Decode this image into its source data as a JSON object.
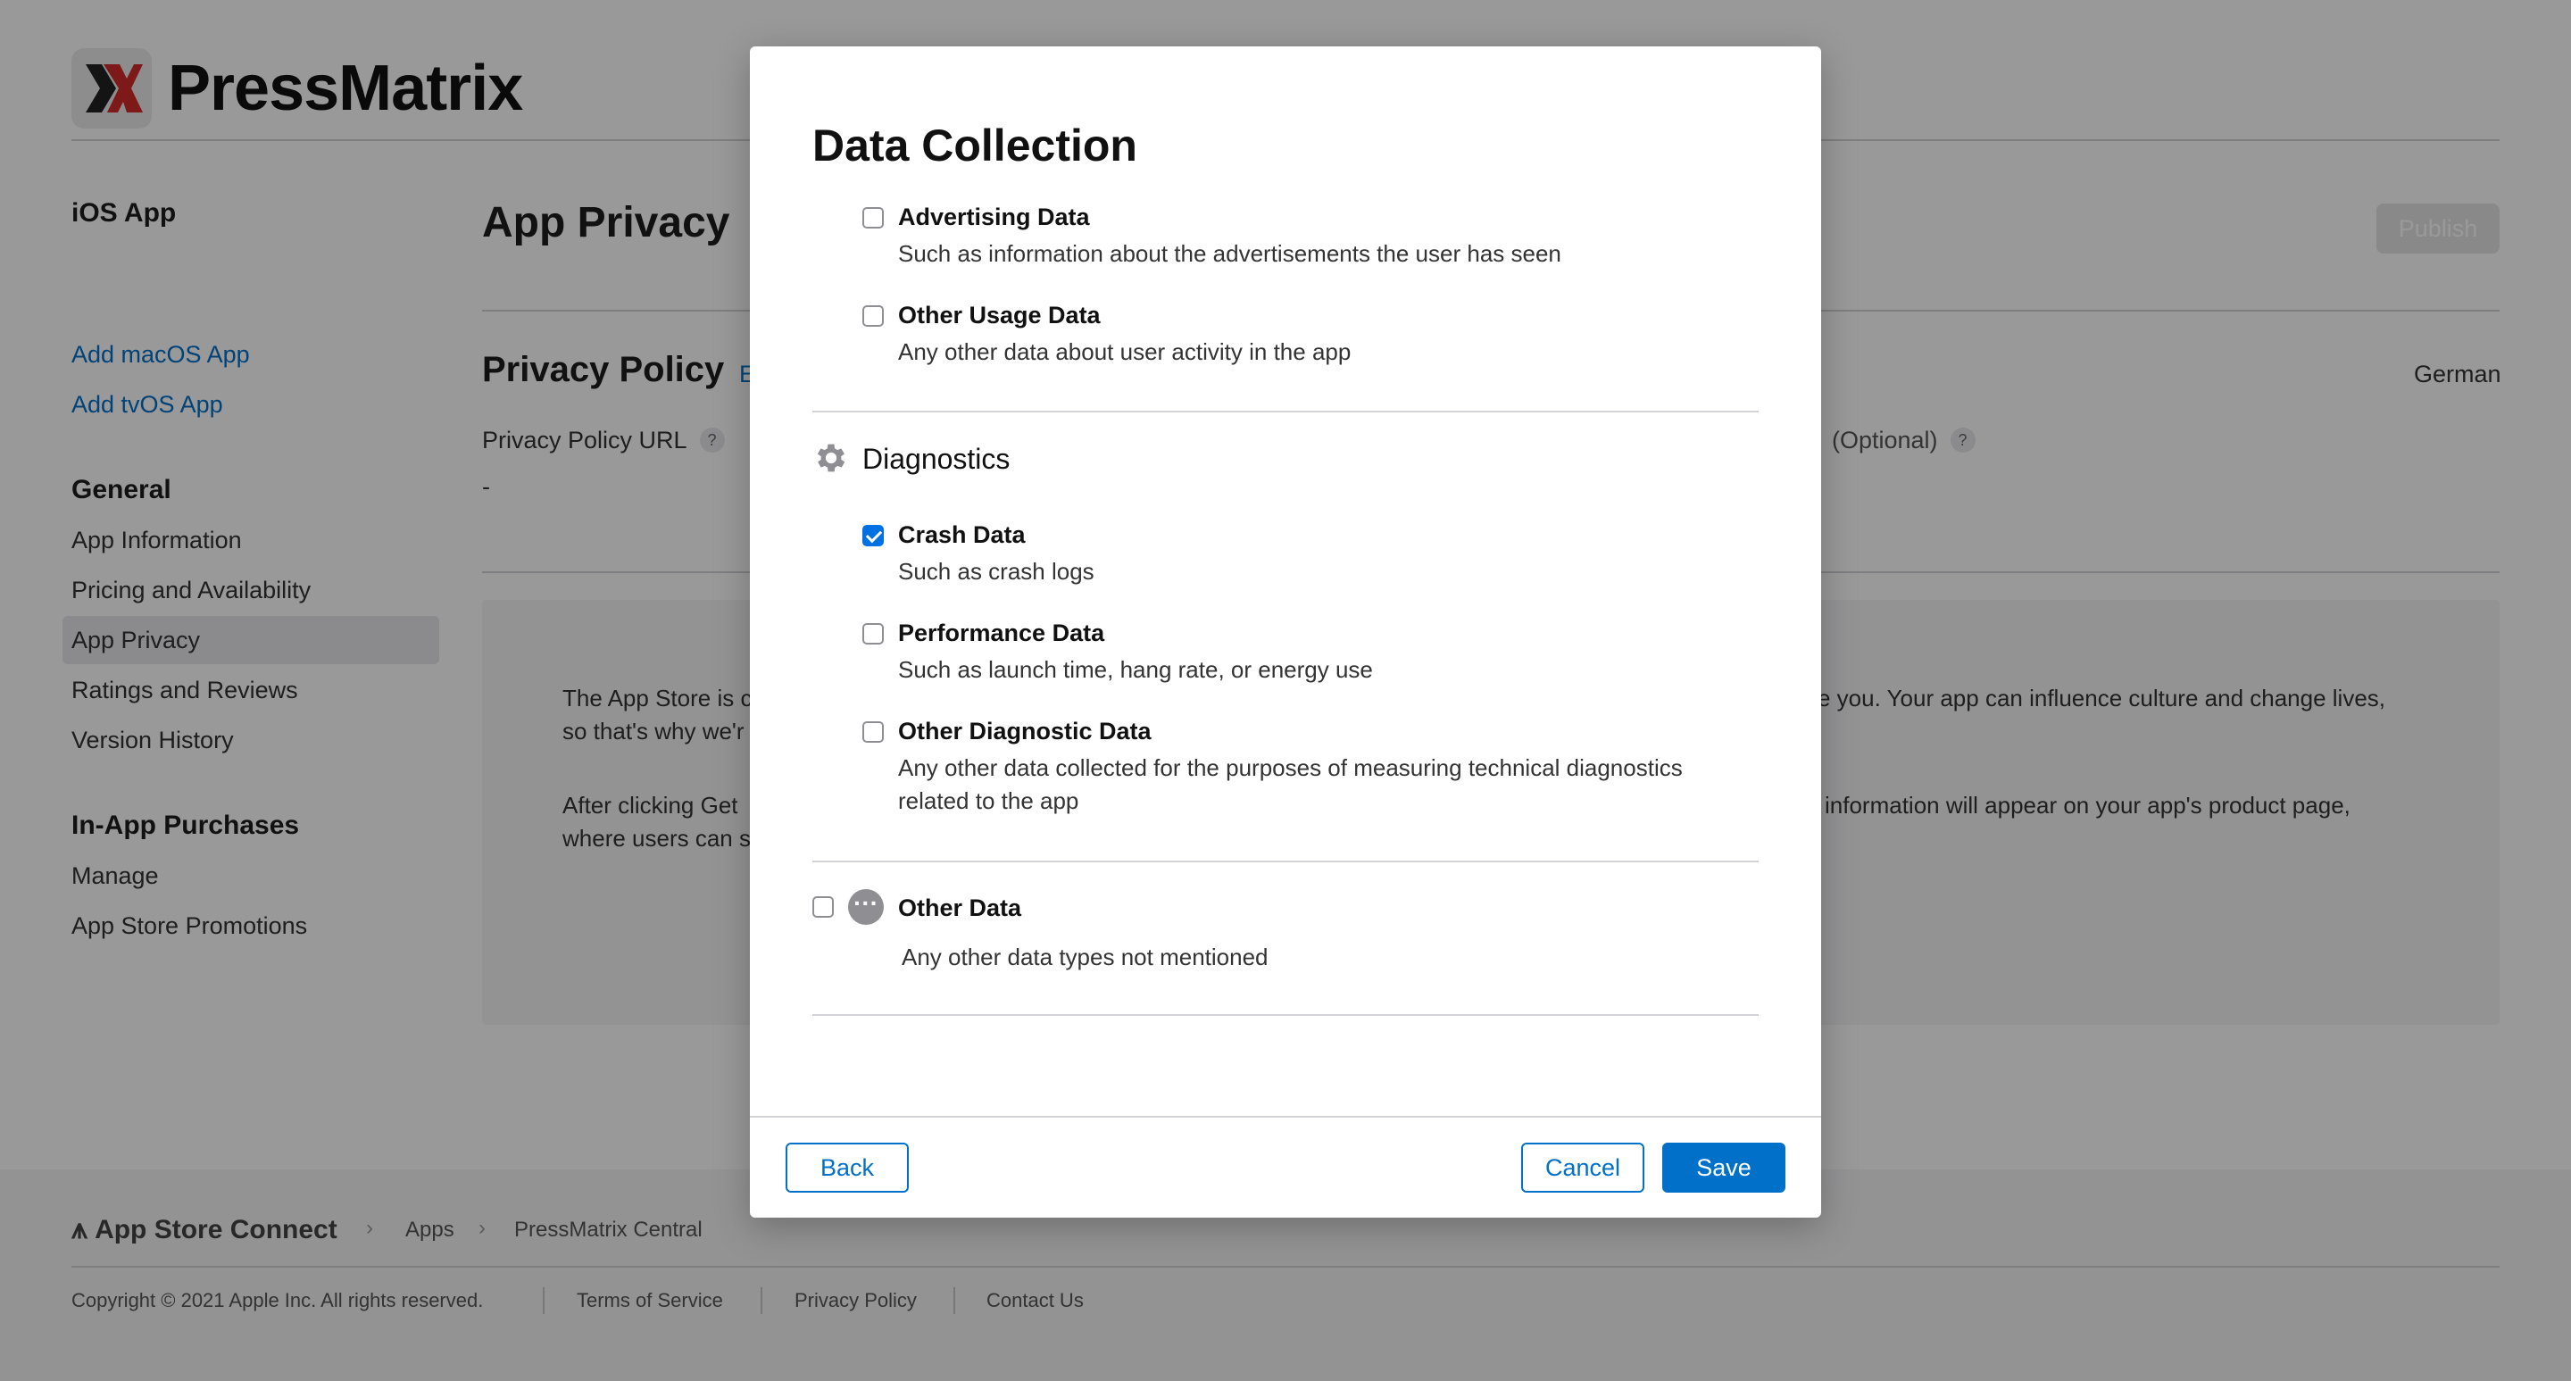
{
  "brand": {
    "name": "PressMatrix",
    "logo_text": "X"
  },
  "sidebar": {
    "app_label": "iOS App",
    "add_links": [
      "Add macOS App",
      "Add tvOS App"
    ],
    "general_heading": "General",
    "general_items": [
      "App Information",
      "Pricing and Availability",
      "App Privacy",
      "Ratings and Reviews",
      "Version History"
    ],
    "active_item": "App Privacy",
    "iap_heading": "In-App Purchases",
    "iap_items": [
      "Manage",
      "App Store Promotions"
    ]
  },
  "main": {
    "title": "App Privacy",
    "publish_label": "Publish",
    "privacy_policy_title": "Privacy Policy",
    "edit_fragment": "E",
    "language": "German",
    "policy_url_label": "Privacy Policy URL",
    "optional_label": "(Optional)",
    "policy_url_value": "-",
    "help_glyph": "?",
    "para1_left": "The App Store is c",
    "para1_left_2": "so that's why we'r",
    "para1_right": "e you. Your app can influence culture and change lives,",
    "para2_left": "After clicking Get",
    "para2_left_2": "where users can s",
    "para2_right": "information will appear on your app's product page,"
  },
  "footer": {
    "brand": "App Store Connect",
    "breadcrumbs": [
      "Apps",
      "PressMatrix Central"
    ],
    "copyright": "Copyright © 2021 Apple Inc. All rights reserved.",
    "links": [
      "Terms of Service",
      "Privacy Policy",
      "Contact Us"
    ]
  },
  "modal": {
    "title": "Data Collection",
    "usage_options": [
      {
        "label": "Advertising Data",
        "desc": "Such as information about the advertisements the user has seen",
        "checked": false
      },
      {
        "label": "Other Usage Data",
        "desc": "Any other data about user activity in the app",
        "checked": false
      }
    ],
    "diagnostics_title": "Diagnostics",
    "diagnostics_options": [
      {
        "label": "Crash Data",
        "desc": "Such as crash logs",
        "checked": true
      },
      {
        "label": "Performance Data",
        "desc": "Such as launch time, hang rate, or energy use",
        "checked": false
      },
      {
        "label": "Other Diagnostic Data",
        "desc": "Any other data collected for the purposes of measuring technical diagnostics",
        "desc2": "related to the app",
        "checked": false
      }
    ],
    "other_data": {
      "label": "Other Data",
      "desc": "Any other data types not mentioned",
      "checked": false,
      "icon_glyph": "···"
    },
    "back_label": "Back",
    "cancel_label": "Cancel",
    "save_label": "Save"
  },
  "colors": {
    "accent": "#0070c9",
    "checked": "#0071e3",
    "overlay": "rgba(0,0,0,0.40)"
  }
}
